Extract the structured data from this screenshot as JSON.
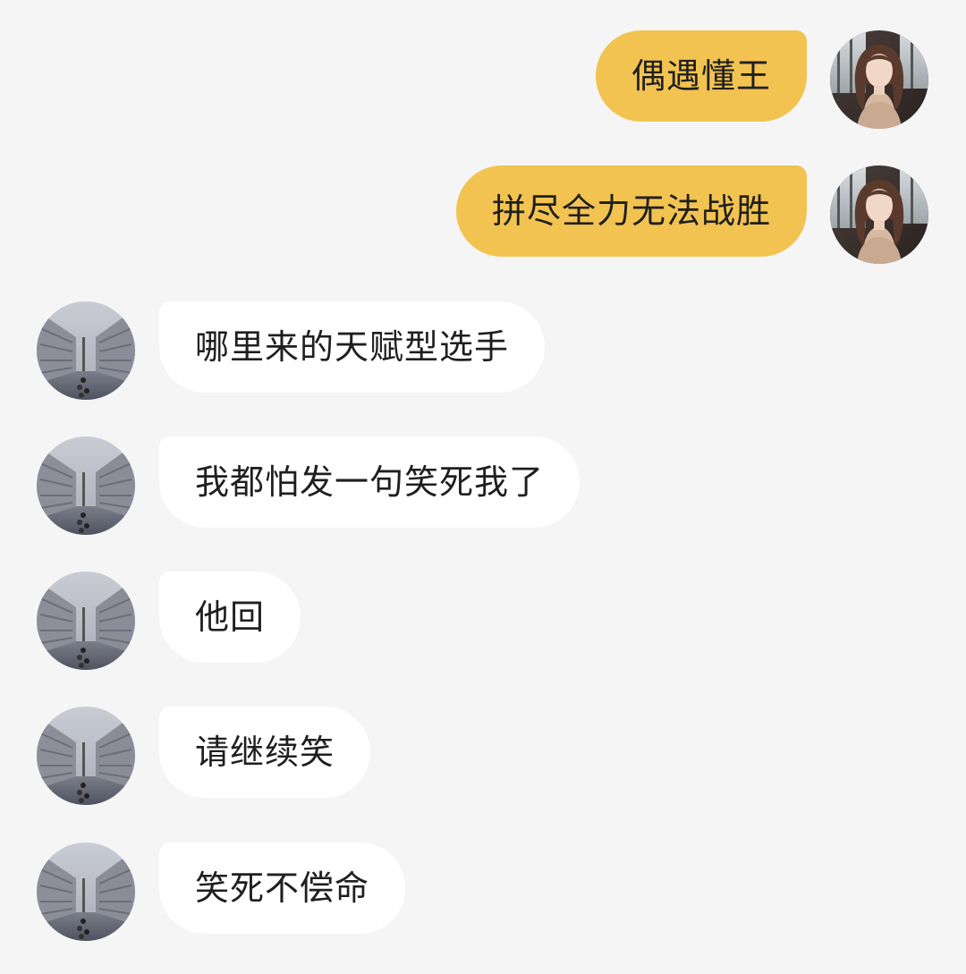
{
  "messages": [
    {
      "side": "me",
      "text": "偶遇懂王"
    },
    {
      "side": "me",
      "text": "拼尽全力无法战胜"
    },
    {
      "side": "other",
      "text": "哪里来的天赋型选手"
    },
    {
      "side": "other",
      "text": "我都怕发一句笑死我了"
    },
    {
      "side": "other",
      "text": "他回"
    },
    {
      "side": "other",
      "text": "请继续笑"
    },
    {
      "side": "other",
      "text": "笑死不偿命"
    }
  ],
  "colors": {
    "background": "#f5f5f5",
    "sent_bubble": "#f2c351",
    "received_bubble": "#ffffff",
    "text": "#1f1f1f"
  },
  "icons": {
    "sender_avatar": "woman-portrait-avatar-icon",
    "receiver_avatar": "city-street-avatar-icon"
  }
}
